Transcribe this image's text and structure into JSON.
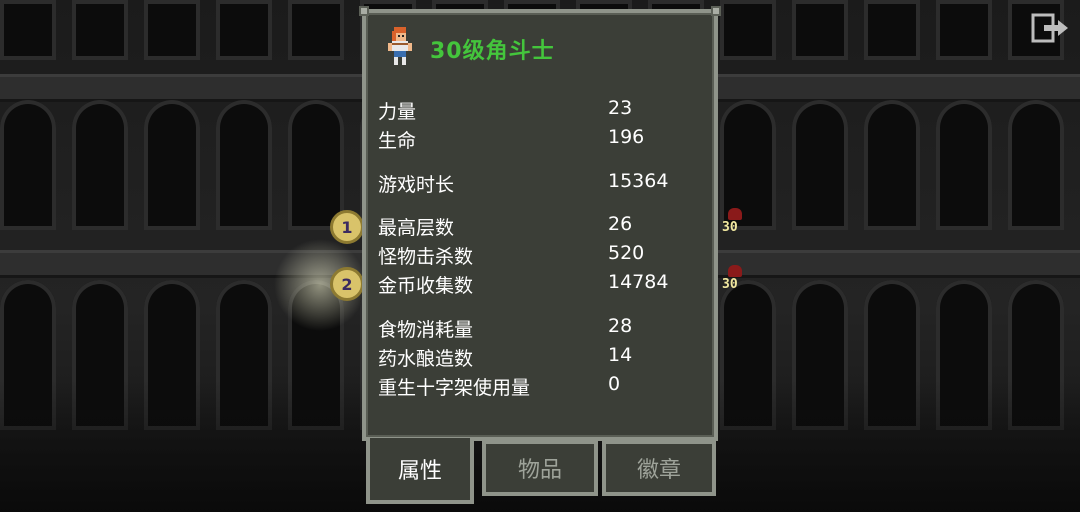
{
  "header": {
    "title": "30级角斗士"
  },
  "stats": [
    {
      "label": "力量",
      "value": "23"
    },
    {
      "label": "生命",
      "value": "196"
    },
    {
      "label": "游戏时长",
      "value": "15364"
    },
    {
      "label": "最高层数",
      "value": "26"
    },
    {
      "label": "怪物击杀数",
      "value": "520"
    },
    {
      "label": "金币收集数",
      "value": "14784"
    },
    {
      "label": "食物消耗量",
      "value": "28"
    },
    {
      "label": "药水酿造数",
      "value": "14"
    },
    {
      "label": "重生十字架使用量",
      "value": "0"
    }
  ],
  "tabs": {
    "attributes": "属性",
    "items": "物品",
    "badges": "徽章"
  },
  "ranks": [
    {
      "rank": "1",
      "level": "30"
    },
    {
      "rank": "2",
      "level": "30"
    }
  ],
  "icons": {
    "exit": "exit-icon",
    "hero": "gladiator-avatar-icon"
  },
  "colors": {
    "title": "#44c53c",
    "panel": "#3b3e37",
    "border": "#8f948a",
    "active_tab_text": "#ffffff",
    "inactive_tab_text": "#9ea39a"
  }
}
